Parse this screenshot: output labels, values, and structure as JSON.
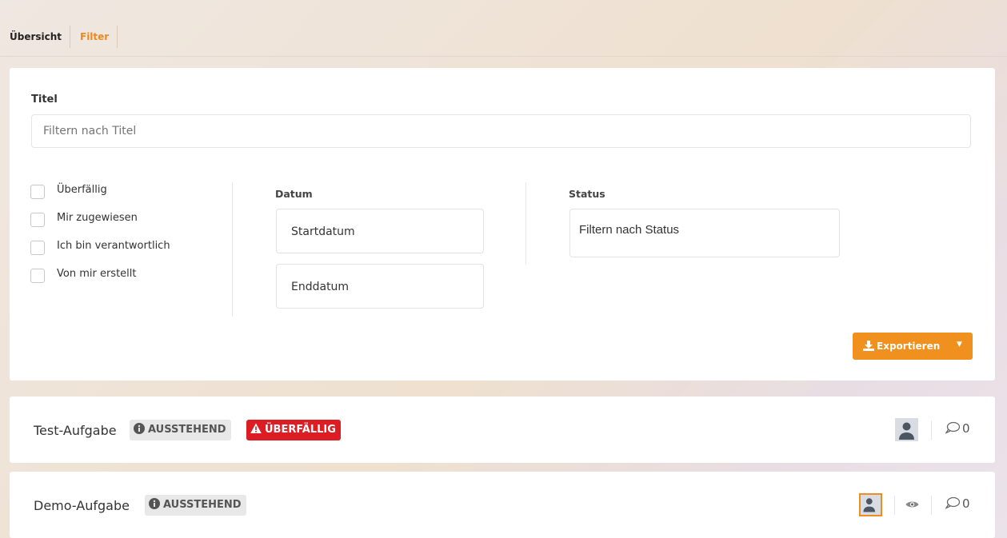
{
  "tabs": [
    {
      "label": "Übersicht"
    },
    {
      "label": "Filter"
    }
  ],
  "filter": {
    "title_label": "Titel",
    "title_placeholder": "Filtern nach Titel",
    "checkboxes": [
      {
        "label": "Überfällig",
        "checked": false
      },
      {
        "label": "Mir zugewiesen",
        "checked": false
      },
      {
        "label": "Ich bin verantwortlich",
        "checked": false
      },
      {
        "label": "Von mir erstellt",
        "checked": false
      }
    ],
    "date_label": "Datum",
    "start_placeholder": "Startdatum",
    "end_placeholder": "Enddatum",
    "status_label": "Status",
    "status_placeholder": "Filtern nach Status",
    "export_label": "Exportieren",
    "export_icon": "download-icon"
  },
  "tasks": [
    {
      "name": "Test-Aufgabe",
      "badges": [
        "AUSSTEHEND",
        "ÜBERFÄLLIG"
      ],
      "comments": "0",
      "watched": false
    },
    {
      "name": "Demo-Aufgabe",
      "badges": [
        "AUSSTEHEND"
      ],
      "comments": "0",
      "watched": true
    }
  ],
  "colors": {
    "accent": "#f0901e",
    "overdue": "#dc1d24",
    "pending_bg": "#e8e8e8"
  }
}
